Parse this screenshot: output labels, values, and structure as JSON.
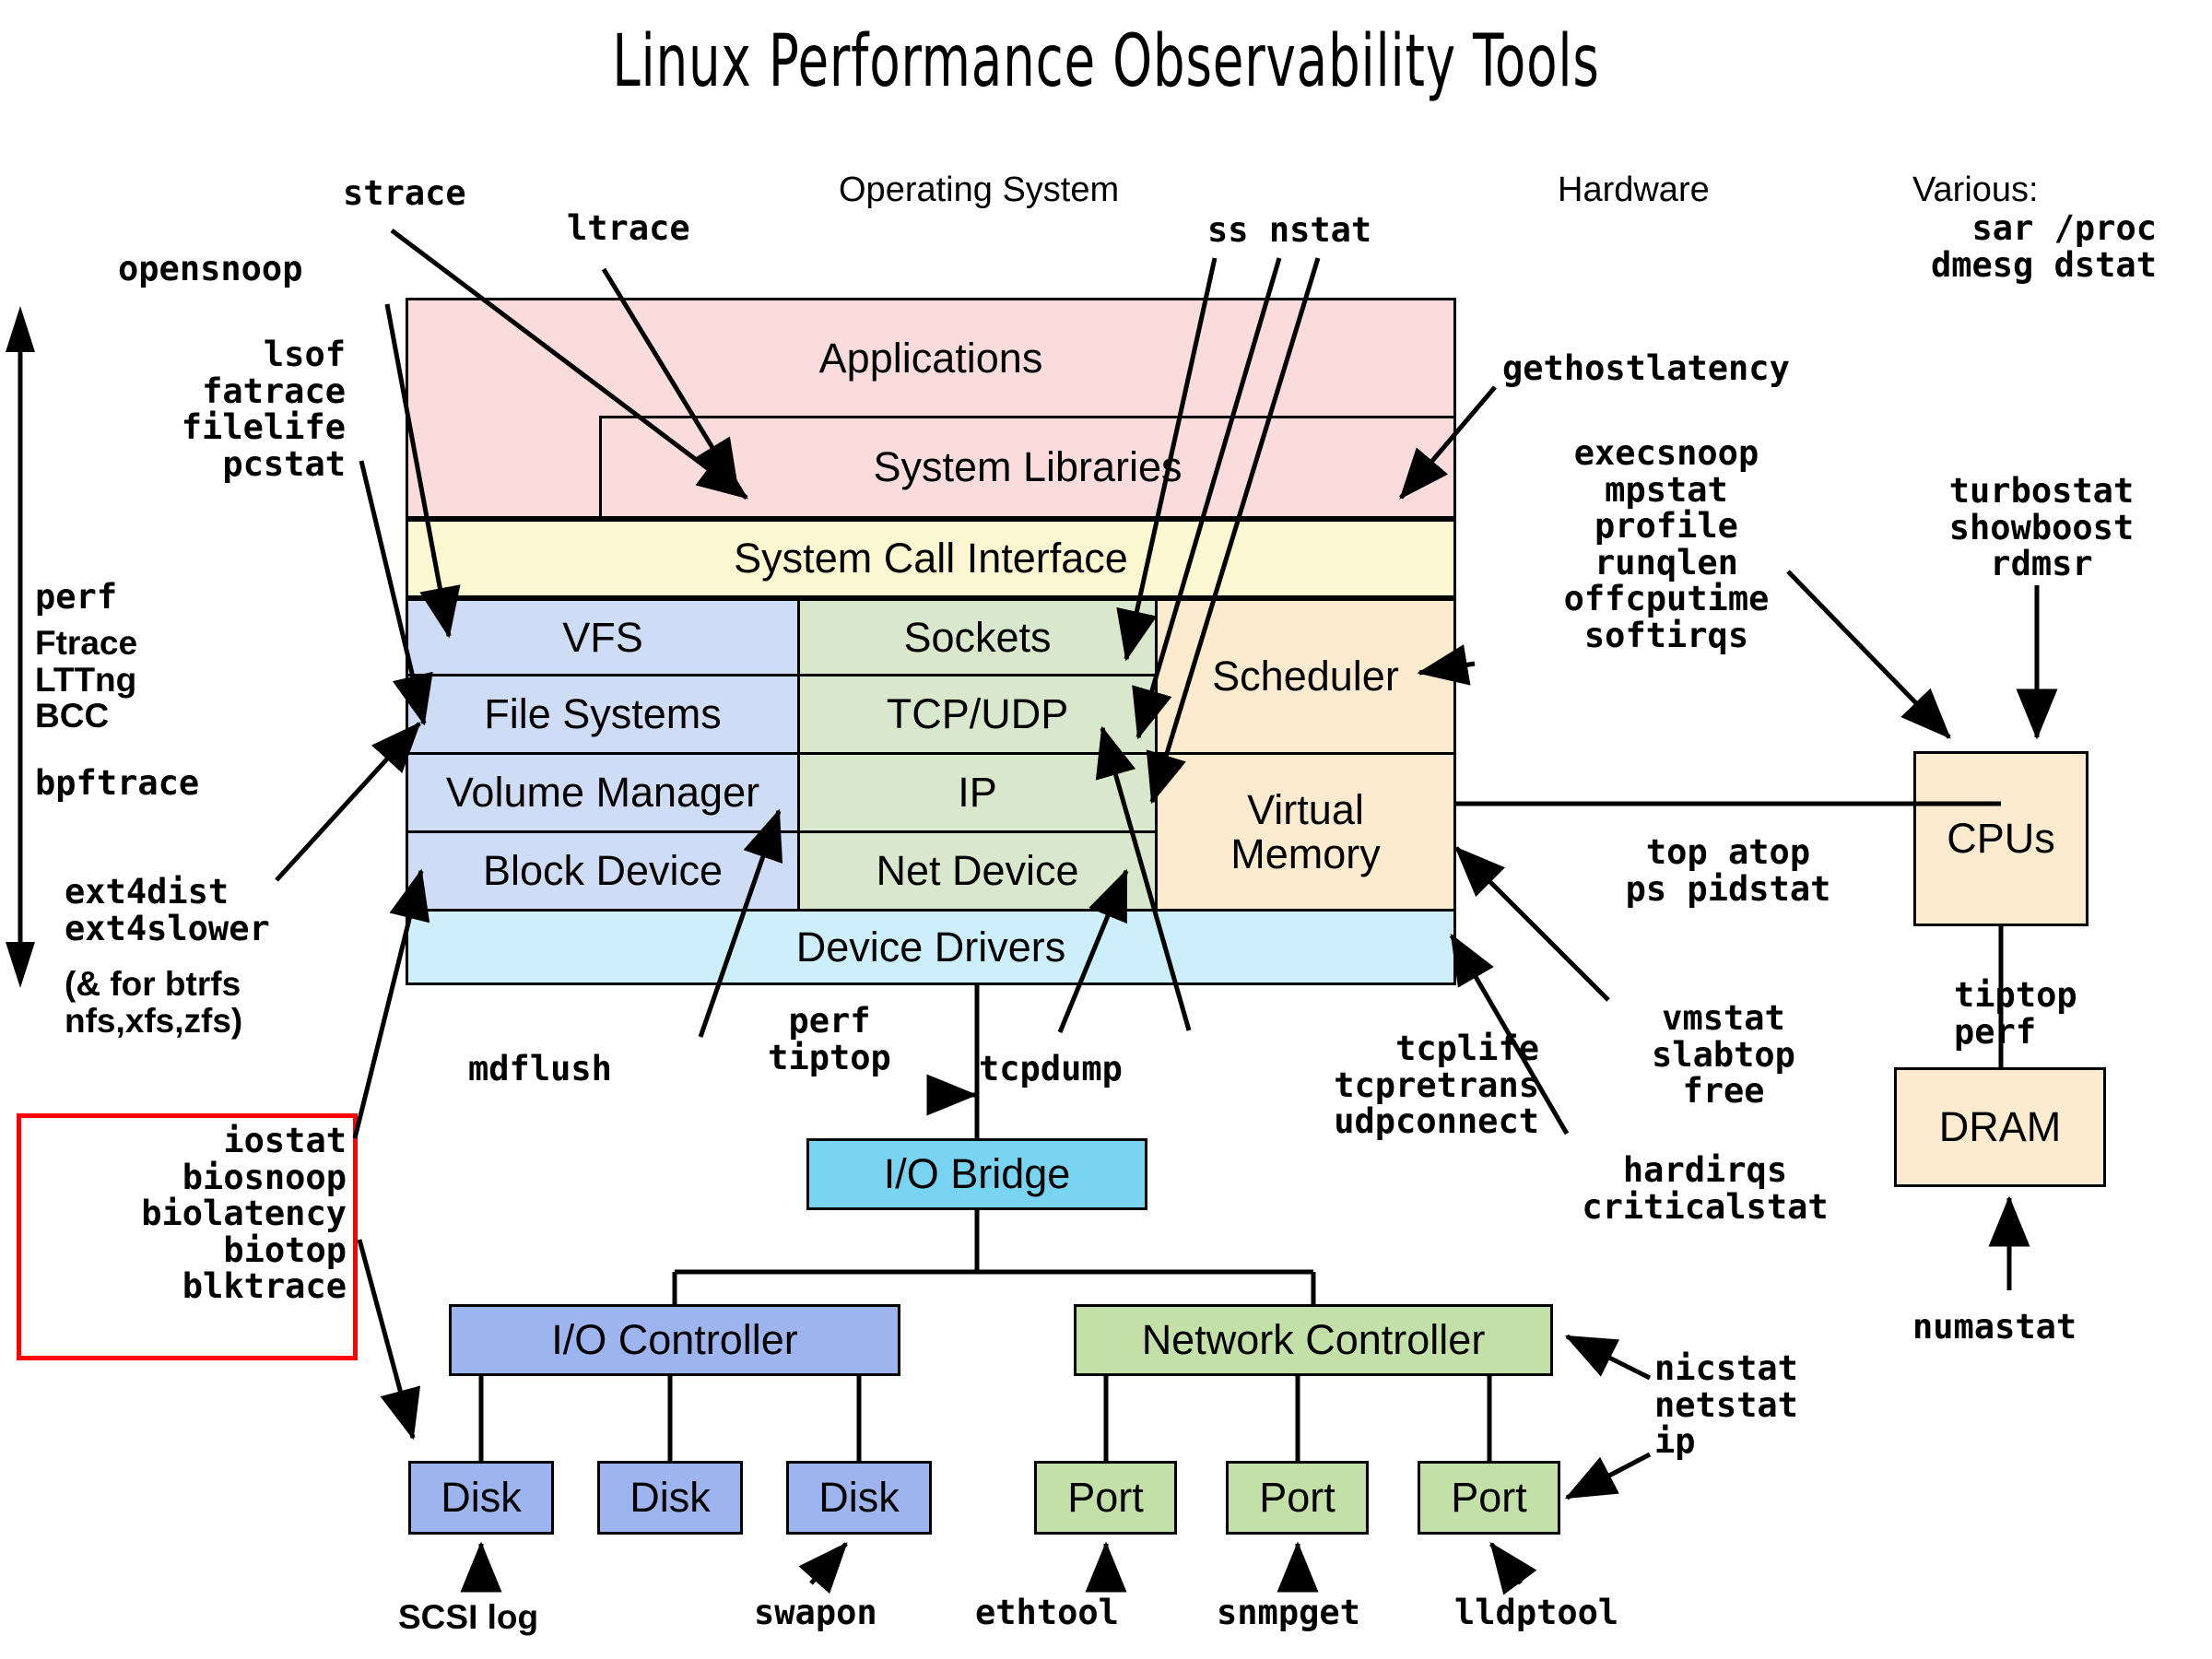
{
  "title": "Linux Performance Observability Tools",
  "section_headers": {
    "os": "Operating System",
    "hardware": "Hardware",
    "various": "Various:"
  },
  "various_tools": "sar /proc\ndmesg dstat",
  "stack": {
    "applications": "Applications",
    "system_libraries": "System Libraries",
    "system_call_interface": "System Call Interface",
    "vfs": "VFS",
    "file_systems": "File Systems",
    "volume_manager": "Volume Manager",
    "block_device": "Block Device",
    "sockets": "Sockets",
    "tcp_udp": "TCP/UDP",
    "ip": "IP",
    "net_device": "Net Device",
    "scheduler": "Scheduler",
    "virtual_memory": "Virtual\nMemory",
    "device_drivers": "Device Drivers"
  },
  "hardware": {
    "cpus": "CPUs",
    "dram": "DRAM",
    "io_bridge": "I/O Bridge",
    "io_controller": "I/O Controller",
    "network_controller": "Network Controller",
    "disk1": "Disk",
    "disk2": "Disk",
    "disk3": "Disk",
    "port1": "Port",
    "port2": "Port",
    "port3": "Port"
  },
  "tools": {
    "strace": "strace",
    "ltrace": "ltrace",
    "opensnoop": "opensnoop",
    "file_group": "lsof\nfatrace\nfilelife\npcstat",
    "tracers_mono_top": "perf",
    "tracers_sans": "Ftrace\nLTTng\nBCC",
    "tracers_mono_bottom": "bpftrace",
    "ext4_mono": "ext4dist\next4slower",
    "ext4_sans": "(& for btrfs\nnfs,xfs,zfs)",
    "block_box": "iostat\nbiosnoop\nbiolatency\nbiotop\nblktrace",
    "ss_nstat": "ss nstat",
    "gethostlatency": "gethostlatency",
    "cpu_tools": "execsnoop\nmpstat\nprofile\nrunqlen\noffcputime\nsoftirqs",
    "turbostat_group": "turbostat\nshowboost\nrdmsr",
    "top_group": "top atop\nps pidstat",
    "vmstat_group": "vmstat\nslabtop\nfree",
    "hardirqs_group": "hardirqs\ncriticalstat",
    "tiptop_perf": "tiptop\nperf",
    "numastat": "numastat",
    "mdflush": "mdflush",
    "perf_tiptop": "perf\ntiptop",
    "tcpdump": "tcpdump",
    "tcp_group": "tcplife\ntcpretrans\nudpconnect",
    "nicstat_group": "nicstat\nnetstat\nip",
    "scsi_log": "SCSI log",
    "swapon": "swapon",
    "ethtool": "ethtool",
    "snmpget": "snmpget",
    "lldptool": "lldptool"
  },
  "colors": {
    "applications": "#fadcdc",
    "syscall": "#fbf8d2",
    "filesystem": "#cfdcf6",
    "network": "#d9e8cd",
    "cpu_mem": "#fdebd0",
    "device_drivers": "#cdeffb",
    "io_bridge": "#79d4f2",
    "io_controller": "#9db4ee",
    "network_controller": "#c3e0a8",
    "highlight_border": "#ff0000"
  }
}
